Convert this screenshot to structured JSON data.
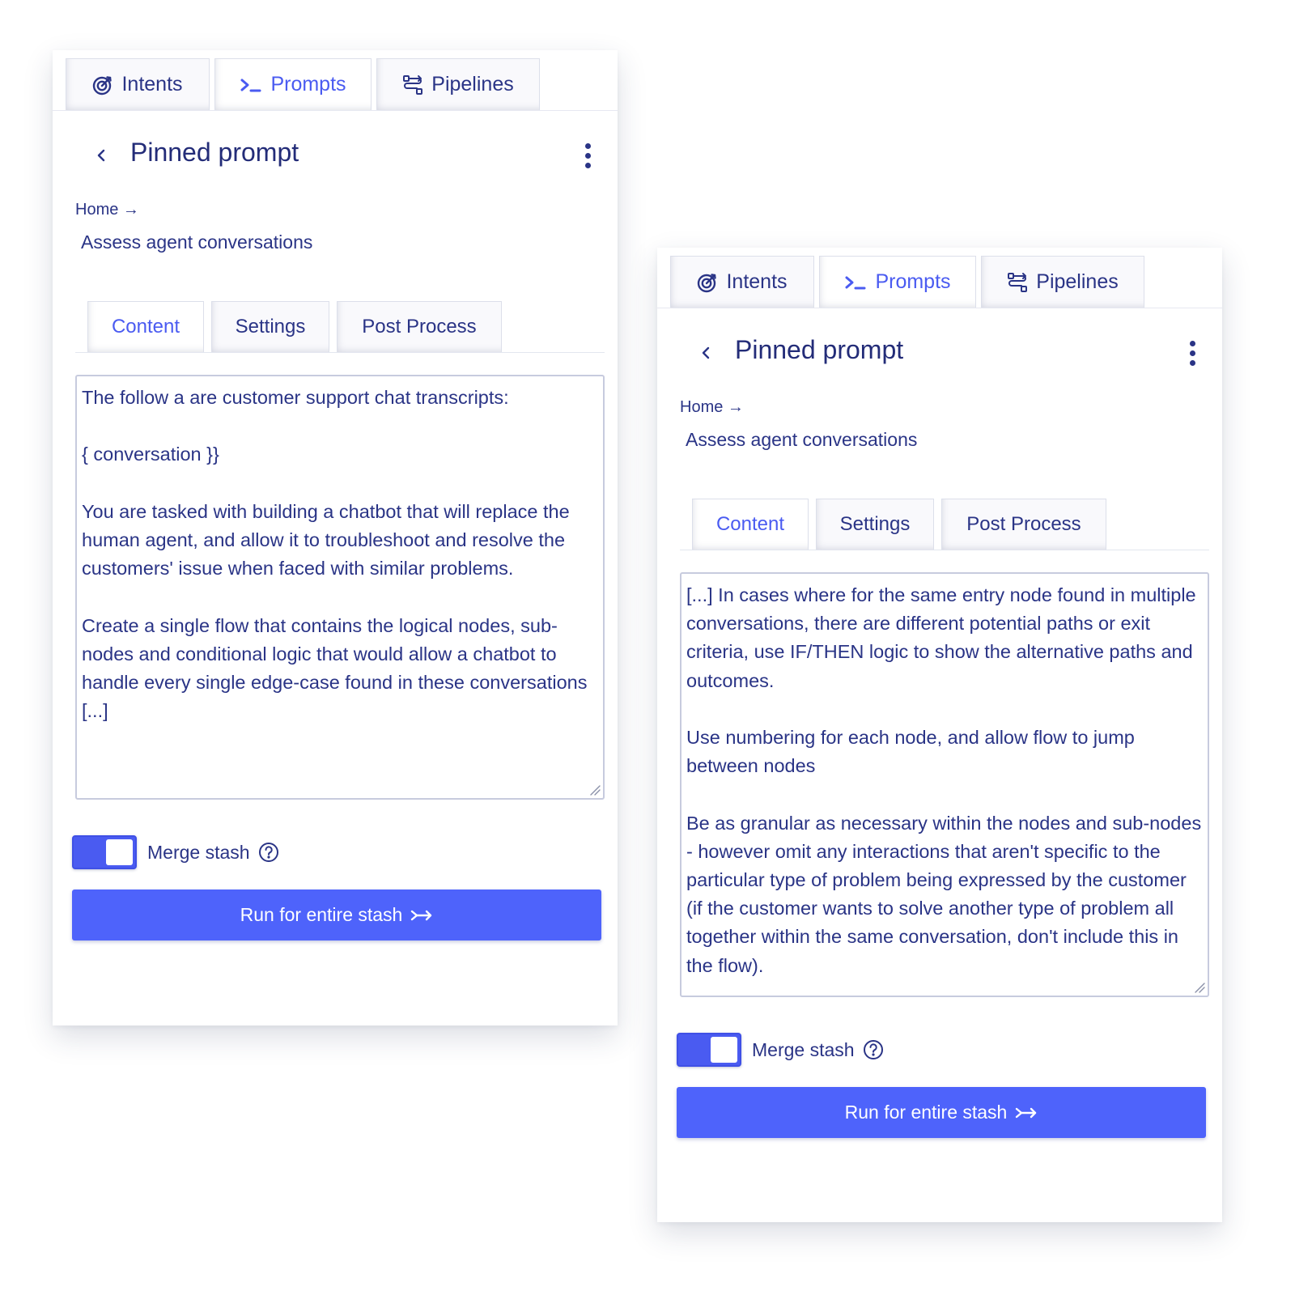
{
  "colors": {
    "accent": "#4a5bf1",
    "text": "#2a3486",
    "button_bg": "#4e63fb",
    "border": "#c7cbde"
  },
  "panels": [
    {
      "top_tabs": [
        {
          "label": "Intents",
          "icon": "target-icon",
          "active": false
        },
        {
          "label": "Prompts",
          "icon": "terminal-icon",
          "active": true
        },
        {
          "label": "Pipelines",
          "icon": "pipeline-icon",
          "active": false
        }
      ],
      "header": {
        "back_icon": "chevron-left-icon",
        "title": "Pinned prompt",
        "menu_icon": "kebab-menu-icon"
      },
      "breadcrumb": "Home →",
      "subtitle": "Assess agent conversations",
      "sub_tabs": [
        {
          "label": "Content",
          "active": true
        },
        {
          "label": "Settings",
          "active": false
        },
        {
          "label": "Post Process",
          "active": false
        }
      ],
      "prompt_text": "The follow a are customer support chat transcripts:\n\n{ conversation }}\n\nYou are tasked with building a chatbot that will replace the human agent, and allow it to troubleshoot and resolve the customers' issue when faced with similar problems.\n\nCreate a single flow that contains the logical nodes, sub-nodes and conditional logic that would allow a chatbot to handle every single edge-case found in these conversations [...]",
      "merge_label": "Merge stash",
      "merge_enabled": true,
      "run_label": "Run for entire stash"
    },
    {
      "top_tabs": [
        {
          "label": "Intents",
          "icon": "target-icon",
          "active": false
        },
        {
          "label": "Prompts",
          "icon": "terminal-icon",
          "active": true
        },
        {
          "label": "Pipelines",
          "icon": "pipeline-icon",
          "active": false
        }
      ],
      "header": {
        "back_icon": "chevron-left-icon",
        "title": "Pinned prompt",
        "menu_icon": "kebab-menu-icon"
      },
      "breadcrumb": "Home →",
      "subtitle": "Assess agent conversations",
      "sub_tabs": [
        {
          "label": "Content",
          "active": true
        },
        {
          "label": "Settings",
          "active": false
        },
        {
          "label": "Post Process",
          "active": false
        }
      ],
      "prompt_text": "[...] In cases where for the same entry node found in multiple conversations, there are different potential paths or exit criteria, use IF/THEN logic to show the alternative paths and outcomes.\n\nUse numbering for each node, and allow flow to jump between nodes\n\nBe as granular as necessary within the nodes and sub-nodes - however omit any interactions that aren't specific to the particular type of problem being expressed by the customer (if the customer wants to solve another type of problem all together within the same conversation, don't include this in the flow).",
      "merge_label": "Merge stash",
      "merge_enabled": true,
      "run_label": "Run for entire stash"
    }
  ]
}
